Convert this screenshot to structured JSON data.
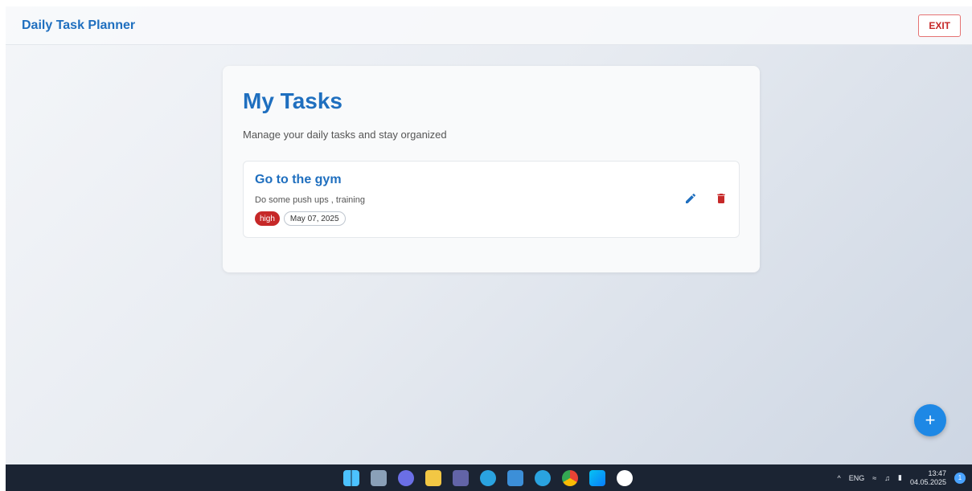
{
  "appbar": {
    "title": "Daily Task Planner",
    "exit_label": "EXIT"
  },
  "main": {
    "title": "My Tasks",
    "subtitle": "Manage your daily tasks and stay organized",
    "tasks": [
      {
        "title": "Go to the gym",
        "description": "Do some push ups , training",
        "priority": "high",
        "date": "May 07, 2025"
      }
    ]
  },
  "fab": {
    "label": "+"
  },
  "taskbar": {
    "tray_language": "ENG",
    "time": "13:47",
    "date": "04.05.2025",
    "notification_count": "1"
  },
  "colors": {
    "accent": "#1f6fbf",
    "danger": "#c62828",
    "fab": "#1e88e5",
    "taskbar": "#1b2433"
  }
}
